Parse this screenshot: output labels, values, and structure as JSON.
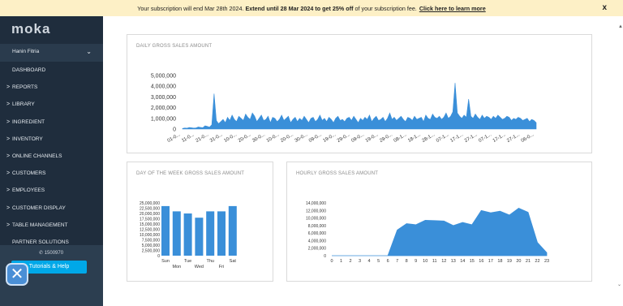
{
  "banner": {
    "text_part1": "Your subscription will end Mar 28th 2024.",
    "text_bold": "Extend until 28 Mar 2024 to get 25% off",
    "text_part2": "of your subscription fee.",
    "link": "Click here to learn more",
    "close": "x"
  },
  "sidebar": {
    "logo": "moka",
    "user_name": "Hanin Fitria",
    "items": [
      {
        "label": "DASHBOARD",
        "caret": ""
      },
      {
        "label": "REPORTS",
        "caret": ">"
      },
      {
        "label": "LIBRARY",
        "caret": ">"
      },
      {
        "label": "INGREDIENT",
        "caret": ">"
      },
      {
        "label": "INVENTORY",
        "caret": ">"
      },
      {
        "label": "ONLINE CHANNELS",
        "caret": ">"
      },
      {
        "label": "CUSTOMERS",
        "caret": ">"
      },
      {
        "label": "EMPLOYEES",
        "caret": ">"
      },
      {
        "label": "CUSTOMER DISPLAY",
        "caret": ">"
      },
      {
        "label": "TABLE MANAGEMENT",
        "caret": ">"
      },
      {
        "label": "PARTNER SOLUTIONS",
        "caret": ""
      }
    ],
    "phone": "1500970",
    "tutorials": "Tutorials & Help"
  },
  "colors": {
    "accent": "#3a8fd9",
    "sidebar": "#1f2d3d",
    "tutorials": "#00a8e8"
  },
  "chart_data": [
    {
      "type": "area",
      "title": "DAILY GROSS SALES AMOUNT",
      "y_ticks": [
        "5,000,000",
        "4,000,000",
        "3,000,000",
        "2,000,000",
        "1,000,000",
        "0"
      ],
      "ylim": [
        0,
        5000000
      ],
      "x_tick_labels": [
        "01-0...",
        "11-0...",
        "21-0...",
        "31-0...",
        "10-0...",
        "20-0...",
        "30-0...",
        "10-0...",
        "20-0...",
        "30-0...",
        "09-0...",
        "19-0...",
        "29-0...",
        "09-0...",
        "19-0...",
        "29-0...",
        "08-1...",
        "18-1...",
        "28-1...",
        "07-1...",
        "17-1...",
        "27-1...",
        "07-1...",
        "17-1...",
        "27-1...",
        "06-0..."
      ],
      "values": [
        50000,
        100000,
        80000,
        150000,
        120000,
        90000,
        110000,
        200000,
        160000,
        130000,
        300000,
        250000,
        180000,
        400000,
        3300000,
        800000,
        500000,
        700000,
        900000,
        600000,
        1100000,
        800000,
        1300000,
        900000,
        700000,
        1200000,
        1000000,
        800000,
        1400000,
        1100000,
        900000,
        1500000,
        1200000,
        700000,
        1000000,
        1300000,
        800000,
        900000,
        1200000,
        600000,
        1100000,
        1000000,
        700000,
        900000,
        1300000,
        800000,
        1000000,
        1200000,
        600000,
        900000,
        1100000,
        700000,
        1000000,
        800000,
        1200000,
        900000,
        600000,
        1000000,
        1100000,
        700000,
        900000,
        1300000,
        800000,
        1000000,
        700000,
        1100000,
        900000,
        600000,
        1000000,
        1200000,
        800000,
        900000,
        700000,
        1000000,
        1100000,
        800000,
        1200000,
        900000,
        600000,
        1000000,
        800000,
        1100000,
        900000,
        1300000,
        700000,
        1000000,
        1200000,
        800000,
        900000,
        1100000,
        700000,
        1000000,
        1500000,
        900000,
        1100000,
        800000,
        1000000,
        1200000,
        900000,
        700000,
        1100000,
        1000000,
        800000,
        1200000,
        900000,
        1000000,
        1100000,
        700000,
        1300000,
        1000000,
        900000,
        1400000,
        1100000,
        1000000,
        1200000,
        900000,
        1100000,
        1500000,
        1000000,
        1200000,
        1600000,
        4300000,
        1500000,
        1200000,
        1000000,
        1300000,
        1100000,
        2800000,
        1200000,
        1000000,
        1400000,
        1100000,
        900000,
        1300000,
        1000000,
        1200000,
        1100000,
        900000,
        1200000,
        1000000,
        1300000,
        1100000,
        900000,
        1000000,
        1200000,
        1100000,
        800000,
        1000000,
        900000,
        1100000,
        1000000,
        800000,
        900000,
        1000000,
        700000,
        900000,
        800000,
        600000
      ]
    },
    {
      "type": "bar",
      "title": "DAY OF THE WEEK GROSS SALES AMOUNT",
      "categories": [
        "Sun",
        "Mon",
        "Tue",
        "Wed",
        "Thu",
        "Fri",
        "Sat"
      ],
      "values": [
        23500000,
        21000000,
        20000000,
        18000000,
        21000000,
        21000000,
        23500000
      ],
      "y_ticks": [
        "25,000,000",
        "22,500,000",
        "20,000,000",
        "17,500,000",
        "15,000,000",
        "12,500,000",
        "10,000,000",
        "7,500,000",
        "5,000,000",
        "2,500,000",
        "0"
      ],
      "ylim": [
        0,
        25000000
      ]
    },
    {
      "type": "area",
      "title": "HOURLY GROSS SALES AMOUNT",
      "categories": [
        "0",
        "1",
        "2",
        "3",
        "4",
        "5",
        "6",
        "7",
        "8",
        "9",
        "10",
        "11",
        "12",
        "13",
        "14",
        "15",
        "16",
        "17",
        "18",
        "19",
        "20",
        "21",
        "22",
        "23"
      ],
      "values": [
        0,
        0,
        0,
        0,
        0,
        0,
        0,
        6800000,
        8500000,
        8200000,
        9400000,
        9300000,
        9200000,
        8000000,
        8800000,
        8200000,
        12000000,
        11400000,
        11800000,
        10800000,
        12600000,
        11500000,
        3500000,
        800000
      ],
      "y_ticks": [
        "14,000,000",
        "12,000,000",
        "10,000,000",
        "8,000,000",
        "6,000,000",
        "4,000,000",
        "2,000,000",
        "0"
      ],
      "ylim": [
        0,
        14000000
      ]
    }
  ]
}
